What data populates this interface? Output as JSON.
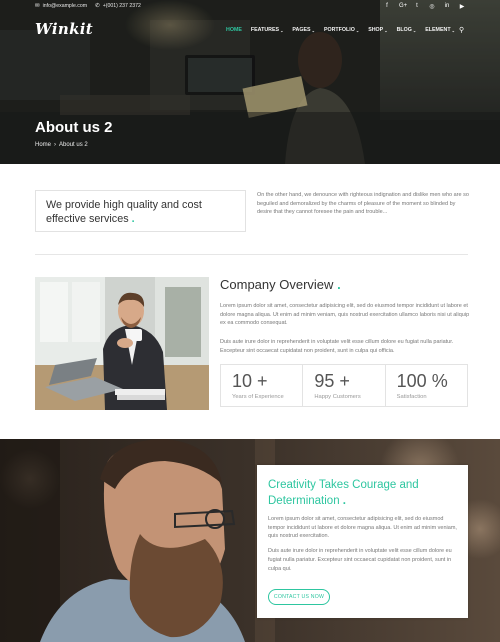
{
  "topbar": {
    "email": "info@example.com",
    "phone": "+(001) 237 2372",
    "social_icons": [
      "facebook-icon",
      "google-plus-icon",
      "twitter-icon",
      "instagram-icon",
      "linkedin-icon",
      "youtube-icon"
    ],
    "social_glyphs": [
      "f",
      "G+",
      "t",
      "◎",
      "in",
      "▶"
    ]
  },
  "logo": "Winkit",
  "nav": {
    "items": [
      {
        "label": "HOME"
      },
      {
        "label": "FEATURES"
      },
      {
        "label": "PAGES"
      },
      {
        "label": "PORTFOLIO"
      },
      {
        "label": "SHOP"
      },
      {
        "label": "BLOG"
      },
      {
        "label": "ELEMENT"
      }
    ],
    "active": "HOME",
    "chevron": "⌄",
    "search_glyph": "⚲"
  },
  "hero": {
    "title": "About us 2",
    "breadcrumb": [
      "Home",
      "›",
      "About us 2"
    ]
  },
  "intro": {
    "heading": "We provide high quality and cost effective services",
    "dot": ".",
    "text": "On the other hand, we denounce with righteous indignation and dislike men who are so beguiled and demoralized by the charms of pleasure of the moment so blinded by desire that they cannot foresee the pain and trouble..."
  },
  "overview": {
    "title": "Company Overview",
    "dot": ".",
    "p1": "Lorem ipsum dolor sit amet, consectetur adipisicing elit, sed do eiusmod tempor incididunt ut labore et dolore magna aliqua. Ut enim ad minim veniam, quis nostrud exercitation ullamco laboris nisi ut aliquip ex ea commodo consequat.",
    "p2": "Duis aute irure dolor in reprehenderit in voluptate velit esse cillum dolore eu fugiat nulla pariatur. Excepteur sint occaecat cupidatat non proident, sunt in culpa qui officia.",
    "stats": [
      {
        "value": "10 +",
        "label": "Years of Experience"
      },
      {
        "value": "95 +",
        "label": "Happy Customers"
      },
      {
        "value": "100 %",
        "label": "Satisfaction"
      }
    ]
  },
  "creativity": {
    "title": "Creativity Takes Courage and Determination",
    "dot": ".",
    "p1": "Lorem ipsum dolor sit amet, consectetur adipisicing elit, sed do eiusmod tempor incididunt ut labore et dolore magna aliqua. Ut enim ad minim veniam, quis nostrud exercitation.",
    "p2": "Duis aute irure dolor in reprehenderit in voluptate velit esse cillum dolore eu fugiat nulla pariatur. Excepteur sint occaecat cupidatat non proident, sunt in culpa qui.",
    "button": "CONTACT US NOW"
  },
  "colors": {
    "accent": "#2ec6a0"
  }
}
